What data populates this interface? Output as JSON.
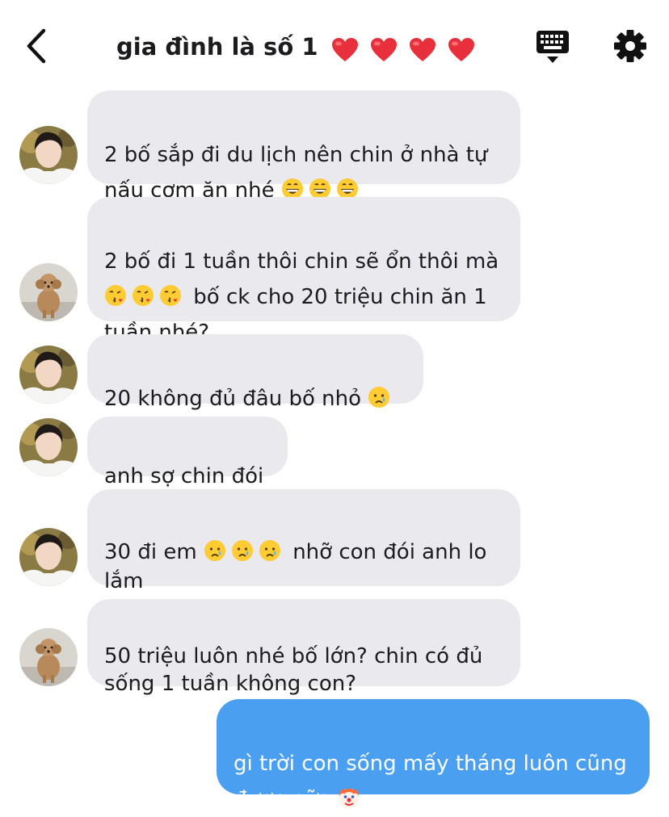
{
  "header": {
    "title": "gia đình là số 1",
    "back_icon": "chevron-left-icon",
    "keyboard_icon": "keyboard-icon",
    "settings_icon": "gear-icon"
  },
  "messages": [
    {
      "sender": "boy",
      "text_line1": "2 bố sắp đi du lịch nên chin ở nhà tự",
      "text_line2": "nấu cơm ăn nhé"
    },
    {
      "sender": "dog",
      "text_line1": "2 bố đi 1 tuần thôi chin sẽ ổn thôi mà",
      "text_line2": " bố ck cho 20 triệu chin ăn 1",
      "text_line3": "tuần nhé?"
    },
    {
      "sender": "boy",
      "text_line1": "20 không đủ đâu bố nhỏ"
    },
    {
      "sender": "boy",
      "text_line1": "anh sợ chin đói"
    },
    {
      "sender": "boy",
      "text_line1": "30 đi em",
      "text_line1b": " nhỡ con đói anh lo",
      "text_line2": "lắm"
    },
    {
      "sender": "dog",
      "text_line1": "50 triệu luôn nhé bố lớn? chin có đủ",
      "text_line2": "sống 1 tuần không con?"
    },
    {
      "sender": "me",
      "text_line1": "gì trời con sống mấy tháng luôn cũng",
      "text_line2": "được nữa"
    }
  ],
  "colors": {
    "incoming_bubble": "#e9e9ee",
    "outgoing_bubble": "#4a9ff0",
    "heart": "#e8303c"
  }
}
